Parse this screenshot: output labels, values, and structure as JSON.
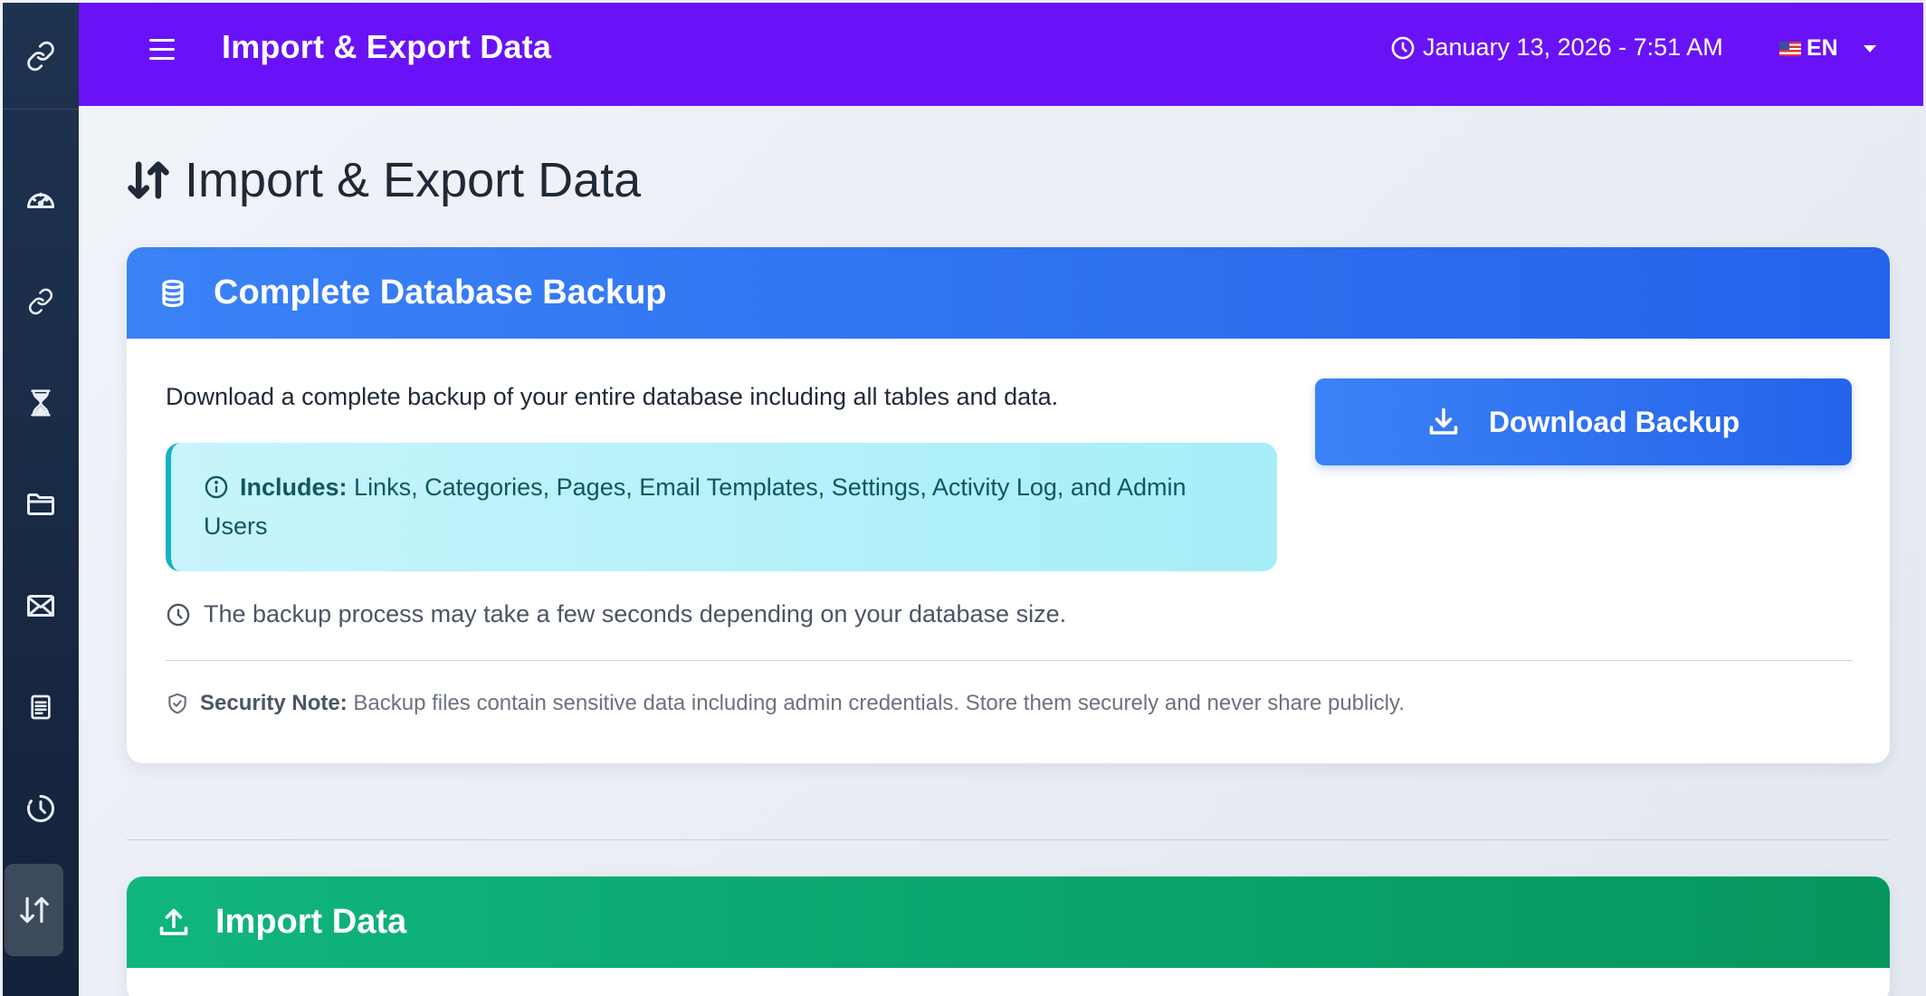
{
  "header": {
    "title": "Import & Export Data",
    "datetime": "January 13, 2026 - 7:51 AM",
    "language": "EN"
  },
  "sidebar": {
    "items": [
      {
        "icon": "dashboard-icon"
      },
      {
        "icon": "link-icon"
      },
      {
        "icon": "hourglass-icon"
      },
      {
        "icon": "folder-icon"
      },
      {
        "icon": "envelope-icon"
      },
      {
        "icon": "document-icon"
      },
      {
        "icon": "history-icon"
      },
      {
        "icon": "import-export-icon",
        "active": true
      }
    ]
  },
  "page": {
    "title": "Import & Export Data"
  },
  "backup": {
    "title": "Complete Database Backup",
    "description": "Download a complete backup of your entire database including all tables and data.",
    "button_label": "Download Backup",
    "includes_label": "Includes:",
    "includes_text": "Links, Categories, Pages, Email Templates, Settings, Activity Log, and Admin Users",
    "process_note": "The backup process may take a few seconds depending on your database size.",
    "security_label": "Security Note:",
    "security_text": "Backup files contain sensitive data including admin credentials. Store them securely and never share publicly."
  },
  "import": {
    "title": "Import Data"
  },
  "colors": {
    "topbar": "#6a12f7",
    "sidebar": "#1e3350",
    "backup_header": "#2563eb",
    "import_header": "#06965e",
    "info_box": "#a6eef8"
  }
}
